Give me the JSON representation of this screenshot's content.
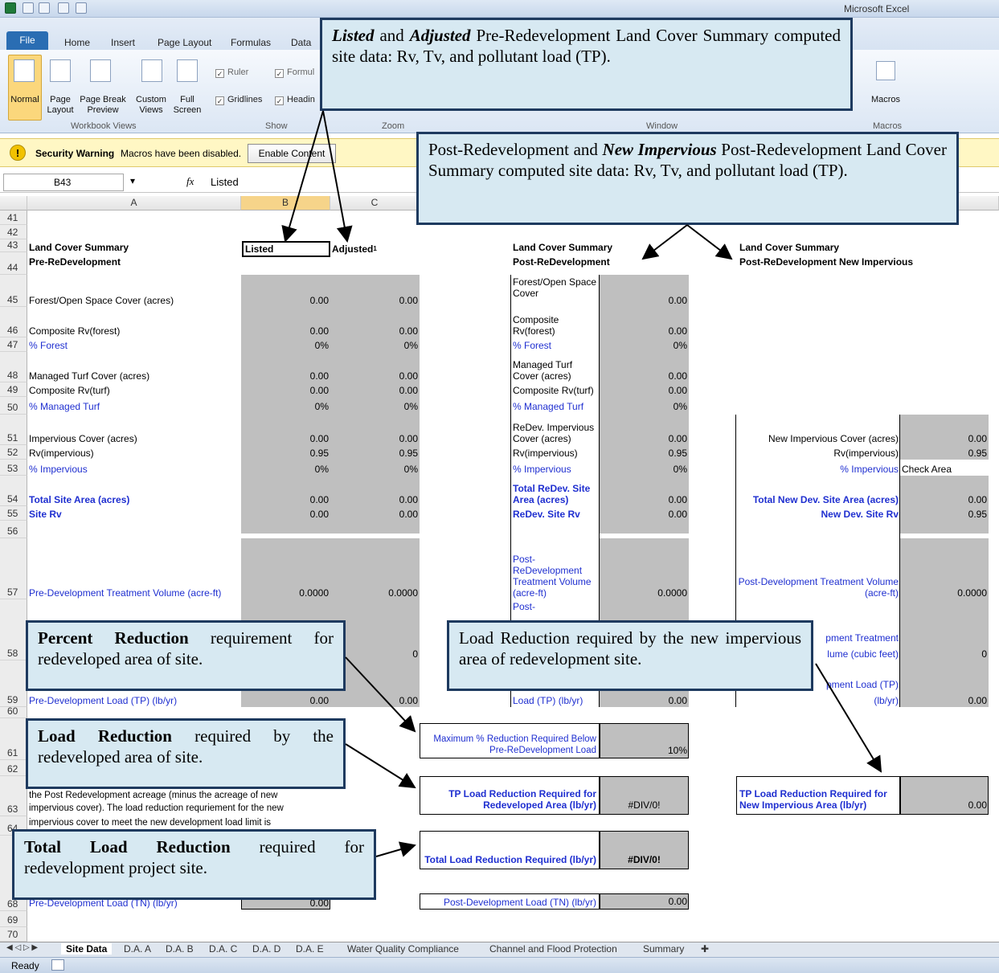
{
  "window": {
    "title_fragment": "Microsoft Excel"
  },
  "ribbon_tabs": [
    "File",
    "Home",
    "Insert",
    "Page Layout",
    "Formulas",
    "Data"
  ],
  "ribbon": {
    "views": [
      "Normal",
      "Page\nLayout",
      "Page Break\nPreview",
      "Custom\nViews",
      "Full\nScreen"
    ],
    "group_workbook_views": "Workbook Views",
    "show_items": [
      "Ruler",
      "Formul",
      "Gridlines",
      "Headin"
    ],
    "group_show": "Show",
    "group_zoom": "Zoom",
    "group_window": "Window",
    "macros": "Macros",
    "group_macros": "Macros"
  },
  "security": {
    "label": "Security Warning",
    "message": "Macros have been disabled.",
    "button": "Enable Content"
  },
  "formula_bar": {
    "cell": "B43",
    "fx": "fx",
    "value": "Listed"
  },
  "columns": [
    "A",
    "B",
    "C"
  ],
  "rows": {
    "r41": "41",
    "r42": "42",
    "r43": "43",
    "r44": "44",
    "r45": "45",
    "r46": "46",
    "r47": "47",
    "r48": "48",
    "r49": "49",
    "r50": "50",
    "r51": "51",
    "r52": "52",
    "r53": "53",
    "r54": "54",
    "r55": "55",
    "r56": "56",
    "r57": "57",
    "r58": "58",
    "r59": "59",
    "r60": "60",
    "r61": "61",
    "r62": "62",
    "r63": "63",
    "r64": "64",
    "r68": "68",
    "r69": "69",
    "r70": "70"
  },
  "pre": {
    "header": "Land Cover Summary",
    "sub": "Pre-ReDevelopment",
    "listed": "Listed",
    "adjusted": "Adjusted",
    "adjusted_sup": "1",
    "labels": {
      "forest": "Forest/Open Space Cover (acres)",
      "rv_forest": "Composite Rv(forest)",
      "pct_forest": "% Forest",
      "turf": "Managed Turf Cover (acres)",
      "rv_turf": "Composite Rv(turf)",
      "pct_turf": "% Managed Turf",
      "imp": "Impervious Cover (acres)",
      "rv_imp": "Rv(impervious)",
      "pct_imp": "% Impervious",
      "total": "Total Site Area (acres)",
      "site_rv": "Site Rv",
      "tv": "Pre-Development Treatment Volume (acre-ft)",
      "load_tp": "Pre-Development Load (TP) (lb/yr)",
      "load_tn": "Pre-Development Load (TN) (lb/yr)"
    },
    "vals": {
      "zero": "0.00",
      "pct0": "0%",
      "rv95": "0.95",
      "tv0": "0.0000",
      "z0": "0"
    },
    "text63": "the Post Redevelopment acreage (minus the acreage of new",
    "text63b": "impervious cover).  The load reduction requriement for the new",
    "text64": "impervious cover to meet the new development load limit is"
  },
  "post": {
    "header": "Land Cover Summary",
    "sub": "Post-ReDevelopment",
    "labels": {
      "forest": "Forest/Open Space Cover",
      "rv_forest": "Composite Rv(forest)",
      "pct_forest": "% Forest",
      "turf": "Managed Turf Cover (acres)",
      "rv_turf": "Composite Rv(turf)",
      "pct_turf": "% Managed Turf",
      "imp": "ReDev. Impervious Cover (acres)",
      "rv_imp": "Rv(impervious)",
      "pct_imp": "% Impervious",
      "total": "Total ReDev. Site Area (acres)",
      "site_rv": "ReDev. Site Rv",
      "tv": "Post-ReDevelopment Treatment Volume (acre-ft)",
      "tv_cf_partial": "Post-",
      "load_tp_partial": "Load (TP) (lb/yr)",
      "max_red": "Maximum % Reduction Required Below Pre-ReDevelopment Load",
      "tp_red": "TP Load Reduction Required for Redeveloped Area (lb/yr)",
      "total_red": "Total Load Reduction Required (lb/yr)",
      "load_tn": "Post-Development Load (TN) (lb/yr)"
    },
    "vals": {
      "zero": "0.00",
      "pct0": "0%",
      "rv95": "0.95",
      "tv0": "0.0000",
      "pct10": "10%",
      "div0": "#DIV/0!"
    }
  },
  "newimp": {
    "header": "Land Cover Summary",
    "sub": "Post-ReDevelopment New Impervious",
    "labels": {
      "imp": "New Impervious Cover (acres)",
      "rv_imp": "Rv(impervious)",
      "pct_imp": "% Impervious",
      "check": "Check Area",
      "total": "Total New Dev. Site Area (acres)",
      "site_rv": "New Dev. Site Rv",
      "tv": "Post-Development Treatment Volume (acre-ft)",
      "tv_cf_a": "pment Treatment",
      "tv_cf_b": "lume (cubic feet)",
      "load_tp_a": "pment Load (TP)",
      "load_tp_b": "(lb/yr)",
      "tp_red": "TP Load Reduction Required for New Impervious Area (lb/yr)"
    },
    "vals": {
      "zero": "0.00",
      "rv95": "0.95",
      "tv0": "0.0000",
      "z0": "0"
    }
  },
  "notes": {
    "listed_adj_i1": "Listed",
    "listed_adj_t1": " and ",
    "listed_adj_i2": "Adjusted",
    "listed_adj_t2": " Pre-Redevelopment Land Cover Summary computed site data: Rv, Tv, and pollutant load (TP).",
    "post_t1": "Post-Redevelopment and ",
    "post_i": "New Impervious",
    "post_t2": " Post-Redevelopment Land Cover Summary computed site data: Rv, Tv, and pollutant load (TP).",
    "pct_b": "Percent Reduction",
    "pct_t": " requirement for redeveloped area of site.",
    "load_t": "Load Reduction required by the new impervious area of redevelopment site.",
    "lr_b": "Load Reduction",
    "lr_t": " required by the redeveloped area of site.",
    "tlr_b": "Total Load Reduction",
    "tlr_t": " required for redevelopment project site."
  },
  "sheet_tabs": [
    "Site Data",
    "D.A. A",
    "D.A. B",
    "D.A. C",
    "D.A. D",
    "D.A. E",
    "Water Quality Compliance",
    "Channel and Flood Protection",
    "Summary"
  ],
  "status": "Ready"
}
